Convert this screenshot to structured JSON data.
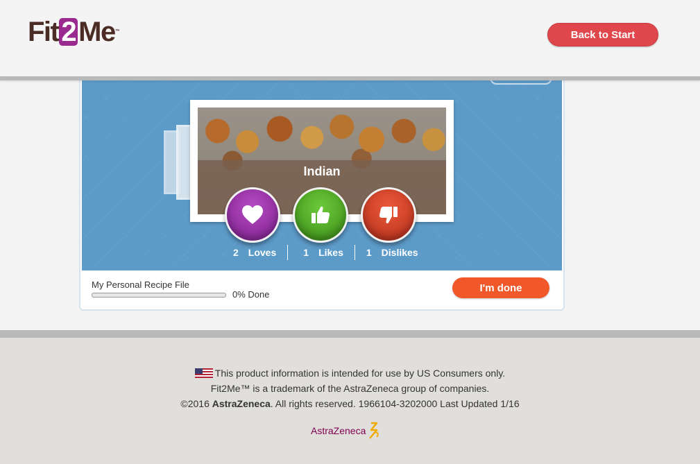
{
  "header": {
    "logo_part1": "Fit",
    "logo_part2": "2",
    "logo_part3": "Me",
    "logo_tm": "™",
    "back_button_label": "Back to Start"
  },
  "card": {
    "category_title": "Indian",
    "votes": {
      "loves": {
        "count": "2",
        "label": "Loves"
      },
      "likes": {
        "count": "1",
        "label": "Likes"
      },
      "dislikes": {
        "count": "1",
        "label": "Dislikes"
      }
    },
    "progress": {
      "label": "My Personal Recipe File",
      "percent": 0,
      "text": "0% Done"
    },
    "done_button_label": "I'm done"
  },
  "footer": {
    "line1": "This product information is intended for use by US Consumers only.",
    "line2": "Fit2Me™ is a trademark of the AstraZeneca group of companies.",
    "line3_prefix": "©2016 ",
    "line3_brand": "AstraZeneca",
    "line3_suffix": ". All rights reserved. 1966104-3202000 Last Updated 1/16",
    "az_logo_text": "AstraZeneca"
  },
  "icons": {
    "love": "heart-icon",
    "like": "thumbs-up-icon",
    "dislike": "thumbs-down-icon",
    "flag": "us-flag-icon"
  },
  "colors": {
    "love": "#9b2a9a",
    "like": "#4caf2a",
    "dislike": "#d8442a",
    "back_button": "#e0474c",
    "done_button": "#f0582a",
    "stage": "#5c9ac8"
  }
}
